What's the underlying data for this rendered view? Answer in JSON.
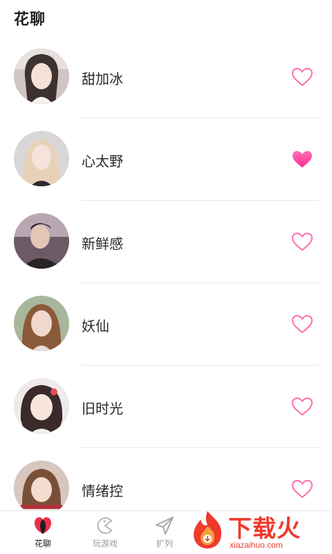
{
  "header": {
    "title": "花聊"
  },
  "contacts": [
    {
      "name": "甜加冰",
      "liked": false
    },
    {
      "name": "心太野",
      "liked": true
    },
    {
      "name": "新鲜感",
      "liked": false
    },
    {
      "name": "妖仙",
      "liked": false
    },
    {
      "name": "旧时光",
      "liked": false
    },
    {
      "name": "情绪控",
      "liked": false
    }
  ],
  "tabbar": {
    "tabs": [
      {
        "label": "花聊",
        "icon": "flower-chat-icon",
        "active": true
      },
      {
        "label": "玩游戏",
        "icon": "game-icon",
        "active": false
      },
      {
        "label": "扩列",
        "icon": "paper-plane-icon",
        "active": false
      }
    ]
  },
  "watermark": {
    "brand": "下载火",
    "domain": "xiazaihuo.com"
  },
  "colors": {
    "heart": "#ff5fa8",
    "heart_fill": "#ff3d9a",
    "brand": "#ef3a2c"
  }
}
